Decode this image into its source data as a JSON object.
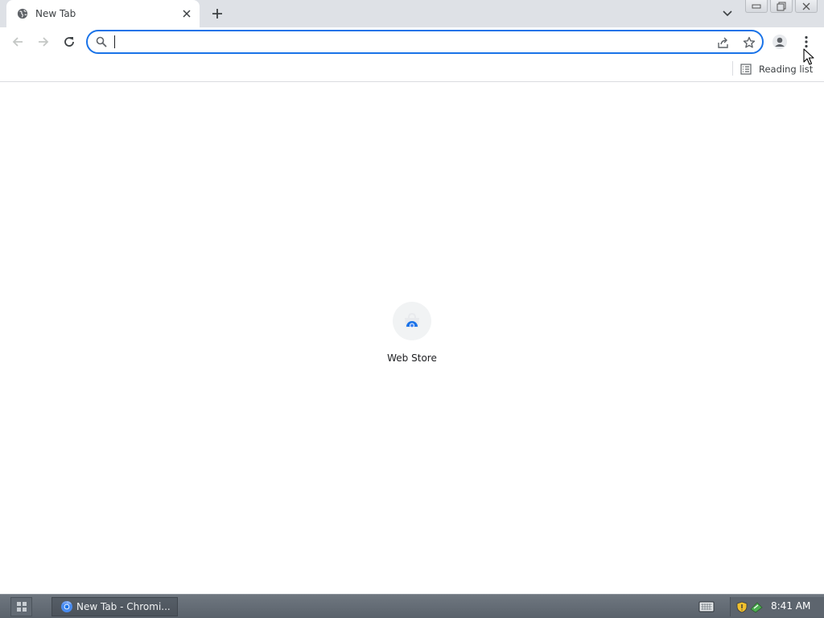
{
  "tab": {
    "title": "New Tab",
    "favicon": "globe-icon",
    "close_icon": "close-icon"
  },
  "tabstrip": {
    "new_tab_icon": "plus-icon",
    "tab_search_icon": "chevron-down-icon"
  },
  "window_controls": [
    "minimize-icon",
    "restore-icon",
    "close-icon"
  ],
  "toolbar": {
    "back_icon": "arrow-left-icon",
    "forward_icon": "arrow-right-icon",
    "reload_icon": "reload-icon",
    "profile_icon": "person-icon",
    "menu_icon": "kebab-menu-icon"
  },
  "omnibox": {
    "value": "",
    "placeholder": "",
    "search_icon": "search-icon",
    "share_icon": "share-icon",
    "bookmark_icon": "star-icon"
  },
  "bookmarks_bar": {
    "reading_list_label": "Reading list"
  },
  "new_tab_page": {
    "shortcuts": [
      {
        "label": "Web Store",
        "icon": "web-store-icon"
      }
    ]
  },
  "taskbar": {
    "task_label": "New Tab - Chromi...",
    "clock": "8:41 AM"
  },
  "colors": {
    "accent": "#1a73e8",
    "tabstrip_bg": "#dee1e6",
    "taskbar_bg": "#5f6770"
  }
}
